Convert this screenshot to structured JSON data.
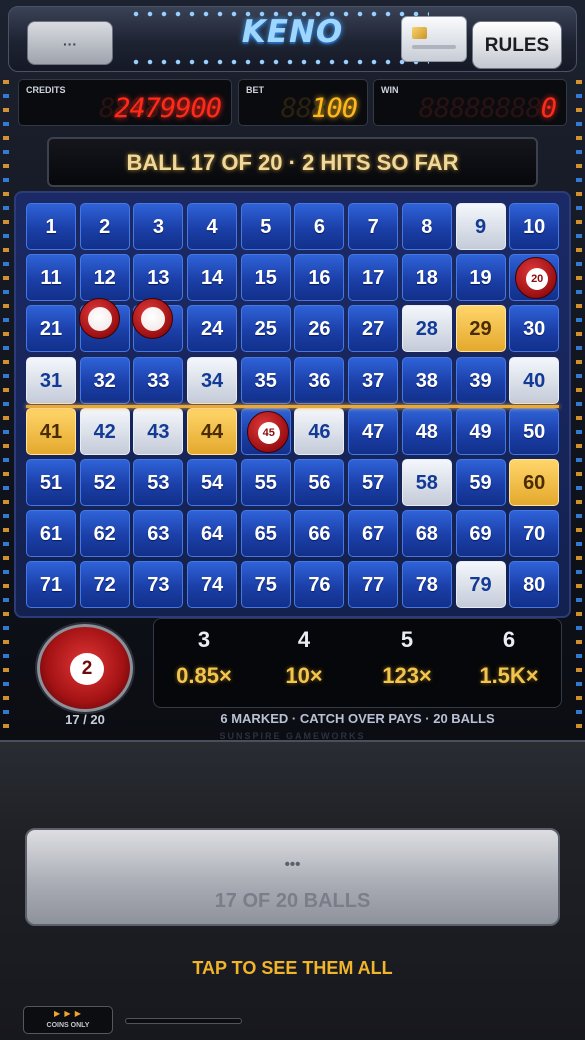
{
  "header": {
    "menu_label": "···",
    "logo": "KENO",
    "card_icon": "card-icon",
    "rules_label": "RULES"
  },
  "meters": {
    "credits_label": "CREDITS",
    "credits_value": "2479900",
    "bet_label": "BET",
    "bet_value": "100",
    "win_label": "WIN",
    "win_value": "0"
  },
  "status": {
    "banner": "BALL 17 OF 20  ·  2 HITS SO FAR"
  },
  "board": {
    "numbers_from": 1,
    "numbers_to": 80,
    "drawn": [
      9,
      28,
      31,
      34,
      40,
      42,
      43,
      46,
      58,
      79
    ],
    "hits": [
      29,
      41,
      44,
      60
    ],
    "ball_markers": [
      {
        "number": 20,
        "label": "20"
      },
      {
        "number": 22,
        "label": ""
      },
      {
        "number": 23,
        "label": ""
      },
      {
        "number": 45,
        "label": "45"
      }
    ],
    "colors": {
      "cell": "#1b3fa8",
      "drawn": "#e6ebf3",
      "hit": "#f0bd45",
      "ball": "#b51416"
    }
  },
  "current_ball": {
    "number": "2",
    "count": "17 / 20"
  },
  "paytable": [
    {
      "catch": "3",
      "pay": "0.85×"
    },
    {
      "catch": "4",
      "pay": "10×"
    },
    {
      "catch": "5",
      "pay": "123×"
    },
    {
      "catch": "6",
      "pay": "1.5K×"
    }
  ],
  "info": {
    "line": "6 MARKED  ·  CATCH OVER PAYS  ·  20 BALLS",
    "maker": "SUNSPIRE GAMEWORKS"
  },
  "action": {
    "dots": "•••",
    "label": "17 OF 20 BALLS",
    "tap_hint": "TAP TO SEE THEM ALL"
  },
  "footer": {
    "coins_arrows": "▶ ▶ ▶",
    "coins_label": "COINS ONLY"
  }
}
